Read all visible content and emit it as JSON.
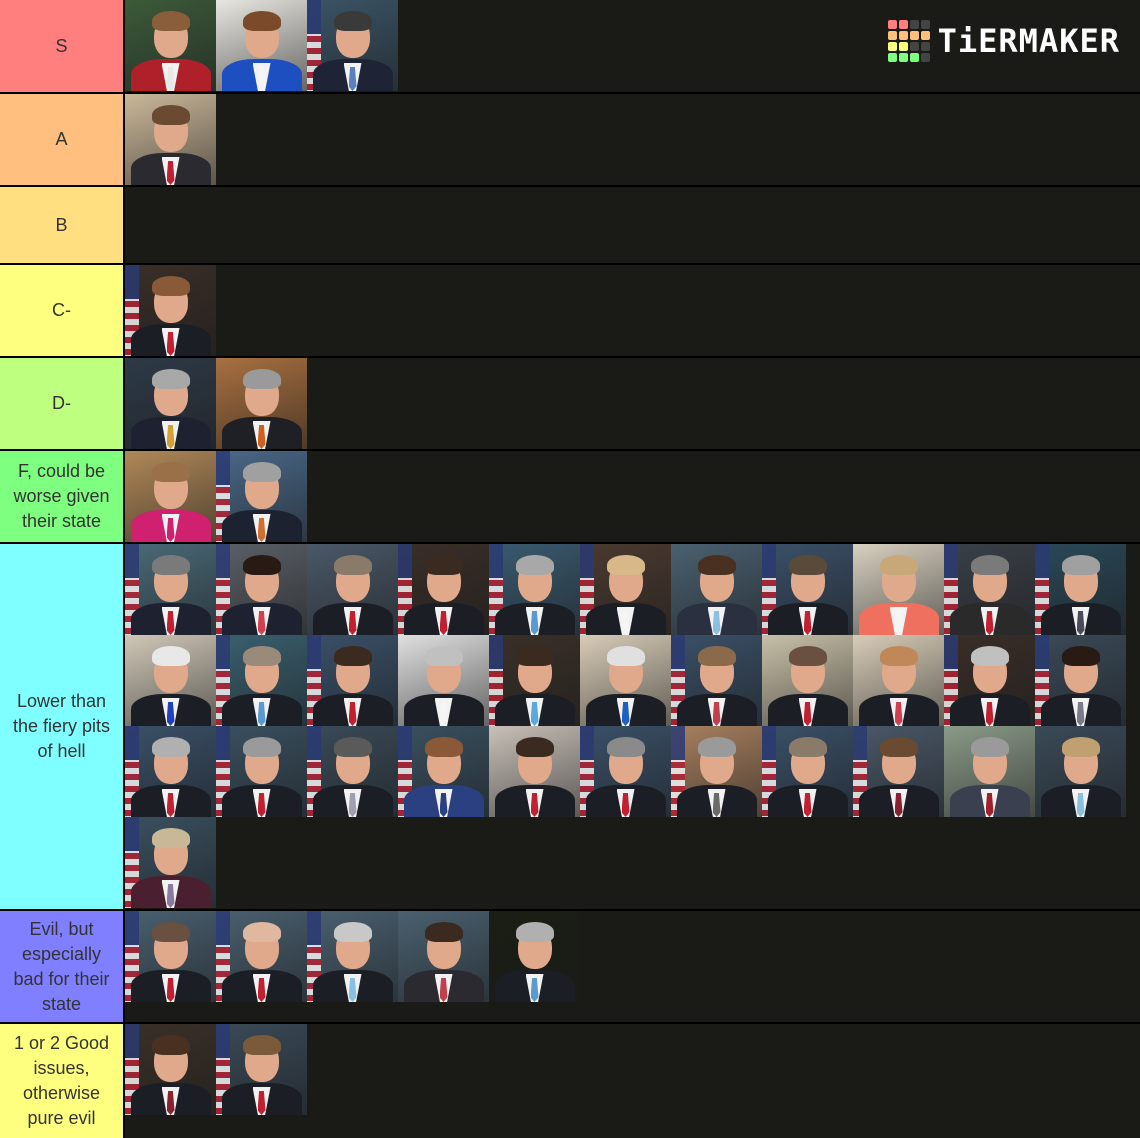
{
  "app": {
    "logo_text": "TiERMAKER"
  },
  "logo_grid_colors": [
    "#ff7f7f",
    "#ff7f7f",
    "#444444",
    "#444444",
    "#ffbf7f",
    "#ffbf7f",
    "#ffbf7f",
    "#ffbf7f",
    "#ffff7f",
    "#ffff7f",
    "#444444",
    "#444444",
    "#7fff7f",
    "#7fff7f",
    "#7fff7f",
    "#444444"
  ],
  "tiers": [
    {
      "label": "S",
      "color": "#ff7f7f",
      "count": 3
    },
    {
      "label": "A",
      "color": "#ffbf7f",
      "count": 1
    },
    {
      "label": "B",
      "color": "#ffdf7f",
      "count": 0
    },
    {
      "label": "C-",
      "color": "#ffff7f",
      "count": 1
    },
    {
      "label": "D-",
      "color": "#bfff7f",
      "count": 2
    },
    {
      "label": "F, could be worse given their state",
      "color": "#7fff7f",
      "count": 2
    },
    {
      "label": "Lower than the fiery pits of hell",
      "color": "#7fffff",
      "count": 34
    },
    {
      "label": "Evil, but especially bad for their state",
      "color": "#7f7fff",
      "count": 5
    },
    {
      "label": "1 or 2 Good issues, otherwise pure evil",
      "color": "#ffff7f",
      "count": 2
    }
  ],
  "portraits": [
    [
      {
        "bg": "#3c5a3a",
        "hair": "#8a5e3a",
        "suit": "#b0202a",
        "tie": "#e8e8e8",
        "flag": false
      },
      {
        "bg": "#e8e6e0",
        "hair": "#7a4a2a",
        "suit": "#1d4fc0",
        "tie": "#f5f5f5",
        "flag": false
      },
      {
        "bg": "#3b5466",
        "hair": "#3a3a3a",
        "suit": "#1e2436",
        "tie": "#5a80c0",
        "flag": true
      }
    ],
    [
      {
        "bg": "#cbb89a",
        "hair": "#6a4a30",
        "suit": "#2a2a30",
        "tie": "#c02030",
        "flag": false
      }
    ],
    [],
    [
      {
        "bg": "#3a2e28",
        "hair": "#8a5a38",
        "suit": "#1c1e26",
        "tie": "#c02030",
        "flag": true
      }
    ],
    [
      {
        "bg": "#2e3a48",
        "hair": "#a8a8a8",
        "suit": "#1e2230",
        "tie": "#d8a030",
        "flag": false
      },
      {
        "bg": "#a87040",
        "hair": "#9a9a9a",
        "suit": "#1e2026",
        "tie": "#d06020",
        "flag": false
      }
    ],
    [
      {
        "bg": "#b08858",
        "hair": "#9a7048",
        "suit": "#d02070",
        "tie": "#d02070",
        "flag": false
      },
      {
        "bg": "#4a6888",
        "hair": "#a0a0a0",
        "suit": "#1c2230",
        "tie": "#d07030",
        "flag": true
      }
    ],
    [
      {
        "bg": "#4a6a78",
        "hair": "#7a7a7a",
        "suit": "#1e2230",
        "tie": "#c02030",
        "flag": true
      },
      {
        "bg": "#5a6068",
        "hair": "#2a1a14",
        "suit": "#1e2230",
        "tie": "#d04050",
        "flag": true
      },
      {
        "bg": "#4a5868",
        "hair": "#8a7a6a",
        "suit": "#1c1e26",
        "tie": "#c02030",
        "flag": false
      },
      {
        "bg": "#3a2e28",
        "hair": "#3a2a20",
        "suit": "#1c1e26",
        "tie": "#c02030",
        "flag": true
      },
      {
        "bg": "#3a5a70",
        "hair": "#a8a8a8",
        "suit": "#1c1e26",
        "tie": "#5a9ad0",
        "flag": true
      },
      {
        "bg": "#4a3a30",
        "hair": "#d8b888",
        "suit": "#1c1e26",
        "tie": "#f5f5f5",
        "flag": true
      },
      {
        "bg": "#4a6070",
        "hair": "#4a3020",
        "suit": "#2a3040",
        "tie": "#8ac0e0",
        "flag": false
      },
      {
        "bg": "#3a5068",
        "hair": "#5a4a3a",
        "suit": "#1c1e26",
        "tie": "#c02030",
        "flag": true
      },
      {
        "bg": "#d8d0c0",
        "hair": "#c8a878",
        "suit": "#f07060",
        "tie": "#f5f5f5",
        "flag": false
      },
      {
        "bg": "#3a4048",
        "hair": "#7a7a7a",
        "suit": "#2a2a2a",
        "tie": "#c02030",
        "flag": true
      },
      {
        "bg": "#2a4858",
        "hair": "#a0a0a0",
        "suit": "#1c1e26",
        "tie": "#4a4a5a",
        "flag": true
      },
      {
        "bg": "#d0c8b8",
        "hair": "#e8e8e8",
        "suit": "#1c1e26",
        "tie": "#2040c0",
        "flag": false
      },
      {
        "bg": "#3a6070",
        "hair": "#9a8a7a",
        "suit": "#1c1e26",
        "tie": "#5a9ad0",
        "flag": true
      },
      {
        "bg": "#3a5068",
        "hair": "#3a2a20",
        "suit": "#1c1e26",
        "tie": "#c02030",
        "flag": true
      },
      {
        "bg": "#e0e0e0",
        "hair": "#c0c0c0",
        "suit": "#1c1e26",
        "tie": "#f5f5f5",
        "flag": false
      },
      {
        "bg": "#3a3028",
        "hair": "#3a2a20",
        "suit": "#1c1e26",
        "tie": "#5aa8e0",
        "flag": true
      },
      {
        "bg": "#d8ccb8",
        "hair": "#e0e0e0",
        "suit": "#1c1e26",
        "tie": "#2060c0",
        "flag": false
      },
      {
        "bg": "#3a5068",
        "hair": "#8a6a4a",
        "suit": "#1c1e26",
        "tie": "#c04050",
        "flag": true
      },
      {
        "bg": "#c8c0a8",
        "hair": "#6a5040",
        "suit": "#1c1e26",
        "tie": "#c02030",
        "flag": false
      },
      {
        "bg": "#d8ccb8",
        "hair": "#c08858",
        "suit": "#1c1e26",
        "tie": "#d04050",
        "flag": false
      },
      {
        "bg": "#3a2e28",
        "hair": "#c0c0c0",
        "suit": "#1c1e26",
        "tie": "#c02030",
        "flag": true
      },
      {
        "bg": "#3a4a58",
        "hair": "#2a1a14",
        "suit": "#1c1e26",
        "tie": "#7a7a8a",
        "flag": true
      },
      {
        "bg": "#3a5068",
        "hair": "#b0b0b0",
        "suit": "#1c1e26",
        "tie": "#c02030",
        "flag": true
      },
      {
        "bg": "#3a5060",
        "hair": "#9a9a9a",
        "suit": "#1c1e26",
        "tie": "#c02030",
        "flag": true
      },
      {
        "bg": "#3a4a58",
        "hair": "#5a5a5a",
        "suit": "#1c1e26",
        "tie": "#a0a0b0",
        "flag": true
      },
      {
        "bg": "#3a5060",
        "hair": "#8a5a38",
        "suit": "#2a4080",
        "tie": "#2a4080",
        "flag": true
      },
      {
        "bg": "#c8c0b8",
        "hair": "#3a2a20",
        "suit": "#1c1e26",
        "tie": "#c02030",
        "flag": false
      },
      {
        "bg": "#3a5068",
        "hair": "#8a8a8a",
        "suit": "#1c1e26",
        "tie": "#c02030",
        "flag": true
      },
      {
        "bg": "#a88060",
        "hair": "#9a9a9a",
        "suit": "#1c1e26",
        "tie": "#6a6a6a",
        "flag": true
      },
      {
        "bg": "#3a5068",
        "hair": "#8a7a6a",
        "suit": "#1c1e26",
        "tie": "#c02030",
        "flag": true
      },
      {
        "bg": "#4a5868",
        "hair": "#6a4a30",
        "suit": "#1c1e26",
        "tie": "#8a2030",
        "flag": true
      },
      {
        "bg": "#8a9a88",
        "hair": "#9a9a9a",
        "suit": "#3a4050",
        "tie": "#a02030",
        "flag": false
      },
      {
        "bg": "#3a4a58",
        "hair": "#c0a070",
        "suit": "#1c1e26",
        "tie": "#8ac0e0",
        "flag": false
      },
      {
        "bg": "#3a5060",
        "hair": "#c8b898",
        "suit": "#4a2030",
        "tie": "#8a7aa0",
        "flag": true
      }
    ],
    [
      {
        "bg": "#4a6070",
        "hair": "#6a5040",
        "suit": "#1c1e26",
        "tie": "#c02030",
        "flag": true
      },
      {
        "bg": "#4a6070",
        "hair": "#e0b8a0",
        "suit": "#1c1e26",
        "tie": "#c02030",
        "flag": true
      },
      {
        "bg": "#4a6070",
        "hair": "#c8c8c8",
        "suit": "#1c1e26",
        "tie": "#8ac0e0",
        "flag": true
      },
      {
        "bg": "#4a6070",
        "hair": "#3a2a20",
        "suit": "#2a2a30",
        "tie": "#c04050",
        "flag": false
      },
      {
        "bg": "#1a1e14",
        "hair": "#b0b0b0",
        "suit": "#1c1e26",
        "tie": "#5a9ad0",
        "flag": false
      }
    ],
    [
      {
        "bg": "#3a3028",
        "hair": "#4a3020",
        "suit": "#1c1e26",
        "tie": "#8a2030",
        "flag": true
      },
      {
        "bg": "#3a4a58",
        "hair": "#7a5a3a",
        "suit": "#1c1e26",
        "tie": "#c02030",
        "flag": true
      }
    ]
  ]
}
